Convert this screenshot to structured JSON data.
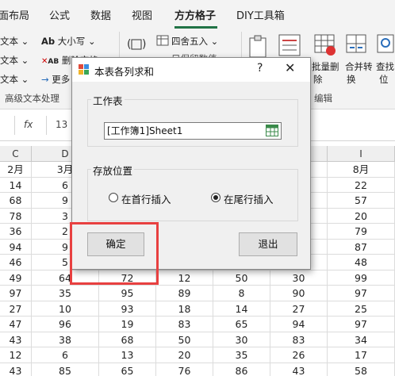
{
  "menubar": {
    "items": [
      "面布局",
      "公式",
      "数据",
      "视图",
      "方方格子",
      "DIY工具箱"
    ]
  },
  "ribbon": {
    "left_items": [
      "文本",
      "文本",
      "文本"
    ],
    "upper_case_label": "大小写",
    "upper_case_icon": "Ab",
    "delete_label": "删除空格",
    "delete_icon": "AB",
    "more_label": "更多",
    "round_label": "四舍五入",
    "only_keep_label": "只保留数值",
    "batch_delete_label": "批量删",
    "batch_delete_label2": "除",
    "merge_label": "合并转",
    "merge_label2": "换",
    "find_label": "查找",
    "find_label2": "位",
    "group_text_label": "高级文本处理",
    "group_edit_label": "编辑"
  },
  "formula_bar": {
    "fx": "fx",
    "value": "13"
  },
  "grid": {
    "col_headers": [
      "C",
      "D",
      "",
      "",
      "",
      "",
      "I"
    ],
    "header_row": [
      "2月",
      "3月",
      "",
      "",
      "",
      "",
      "8月"
    ],
    "rows": [
      [
        "14",
        "6",
        "",
        "",
        "",
        "",
        "22"
      ],
      [
        "68",
        "9",
        "",
        "",
        "",
        "",
        "57"
      ],
      [
        "78",
        "3",
        "",
        "",
        "",
        "",
        "20"
      ],
      [
        "36",
        "2",
        "",
        "",
        "",
        "",
        "79"
      ],
      [
        "94",
        "9",
        "",
        "",
        "",
        "",
        "87"
      ],
      [
        "46",
        "5",
        "",
        "",
        "",
        "",
        "48"
      ],
      [
        "49",
        "64",
        "72",
        "12",
        "50",
        "30",
        "99"
      ],
      [
        "97",
        "35",
        "95",
        "89",
        "8",
        "90",
        "97"
      ],
      [
        "27",
        "10",
        "93",
        "18",
        "14",
        "27",
        "25"
      ],
      [
        "47",
        "96",
        "19",
        "83",
        "65",
        "94",
        "97"
      ],
      [
        "43",
        "38",
        "68",
        "50",
        "30",
        "83",
        "34"
      ],
      [
        "12",
        "6",
        "13",
        "20",
        "35",
        "26",
        "17"
      ],
      [
        "43",
        "85",
        "65",
        "76",
        "86",
        "43",
        "58"
      ]
    ]
  },
  "dialog": {
    "title": "本表各列求和",
    "help": "?",
    "close": "✕",
    "worksheet_legend": "工作表",
    "worksheet_value": "[工作簿1]Sheet1",
    "position_legend": "存放位置",
    "radio_first": "在首行插入",
    "radio_last": "在尾行插入",
    "ok_label": "确定",
    "exit_label": "退出"
  },
  "colors": {
    "accent": "#217346",
    "highlight": "#e84040"
  }
}
